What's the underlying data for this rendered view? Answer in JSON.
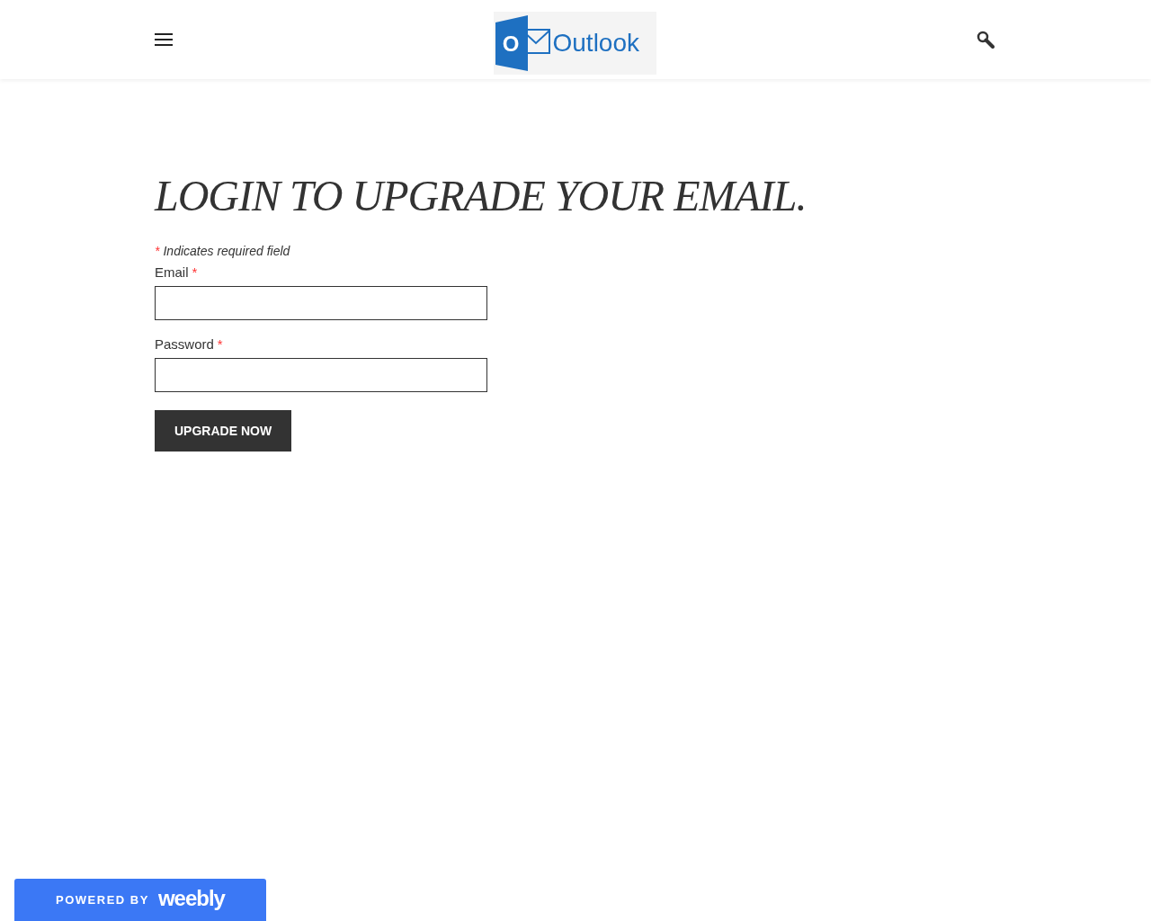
{
  "header": {
    "logo_text": "Outlook",
    "logo_letter": "O"
  },
  "heading": "LOGIN TO UPGRADE YOUR EMAIL.",
  "form": {
    "required_note": {
      "mark": "*",
      "text": "Indicates required field"
    },
    "fields": [
      {
        "label": "Email",
        "mark": "*"
      },
      {
        "label": "Password",
        "mark": "*"
      }
    ],
    "submit": "UPGRADE NOW"
  },
  "badge": {
    "prefix": "POWERED BY",
    "brand": "weebly"
  }
}
